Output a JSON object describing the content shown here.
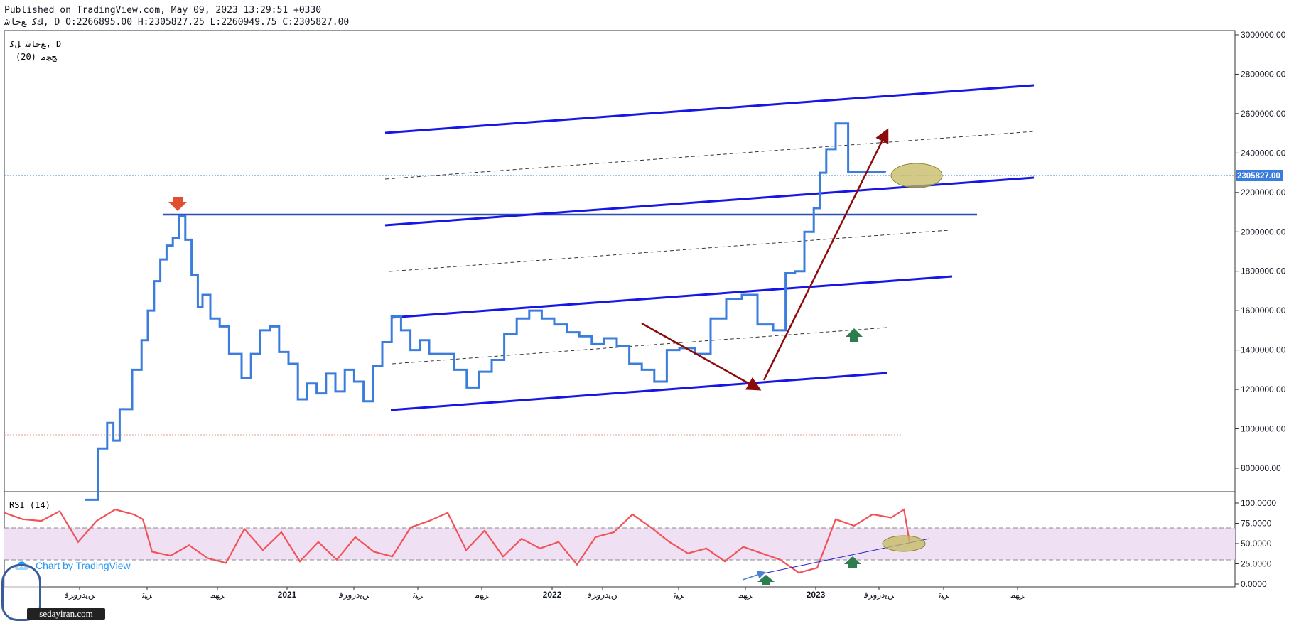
{
  "header": {
    "published": "Published on TradingView.com, May 09, 2023 13:29:51 +0330",
    "symbol_line": "ﻚﮐ ﻊﺧﺎﺷ, D O:2266895.00 H:2305827.25 L:2260949.75 C:2305827.00"
  },
  "legend": {
    "main": "ﻊﺧﺎﺷ ﻞﮐ, D",
    "sub": "(20) ﺞﺠﻣ"
  },
  "rsi": {
    "label": "RSI (14)"
  },
  "price_badge": "2305827.00",
  "brand": {
    "label": "Chart by TradingView"
  },
  "watermark": {
    "text": "sedayiran.com"
  },
  "colors": {
    "price": "#3b7ddd",
    "rsi": "#f05459",
    "channel": "#1616e6",
    "arrow": "#8b0a0a",
    "band": "#f0e0f4",
    "ellipse": "#c4b860",
    "green": "#2e7d4f",
    "red_marker": "#e05030"
  },
  "chart_data": [
    {
      "type": "line",
      "title": "",
      "ylim": [
        620000,
        3050000
      ],
      "y_ticks": [
        "3000000.00",
        "2800000.00",
        "2600000.00",
        "2400000.00",
        "2200000.00",
        "2000000.00",
        "1800000.00",
        "1600000.00",
        "1400000.00",
        "1200000.00",
        "1000000.00",
        "800000.00"
      ],
      "x_ticks": [
        "ﻦﯾﺩﺭﻭﺮﻓ",
        "ﺮﯿﺗ",
        "ﺮﻬﻣ",
        "2021",
        "ﻦﯾﺩﺭﻭﺮﻓ",
        "ﺮﯿﺗ",
        "ﺮﻬﻣ",
        "2022",
        "ﻦﯾﺩﺭﻭﺮﻓ",
        "ﺮﯿﺗ",
        "ﺮﻬﻣ",
        "2023",
        "ﻦﯾﺩﺭﻭﺮﻓ",
        "ﺮﯿﺗ",
        "ﺮﻬﻣ"
      ],
      "series": [
        {
          "x": [
            0,
            8,
            14,
            18,
            22,
            30,
            36,
            40,
            44,
            48,
            52,
            56,
            60,
            64,
            68,
            72,
            75,
            80,
            86,
            92,
            100,
            106,
            112,
            118,
            124,
            130,
            136,
            142,
            148,
            154,
            160,
            166,
            172,
            178,
            184,
            190,
            196,
            202,
            208,
            214,
            220,
            228,
            236,
            244,
            252,
            260,
            268,
            276,
            284,
            292,
            300,
            308,
            316,
            324,
            332,
            340,
            348,
            356,
            364,
            372,
            380,
            390,
            400,
            410,
            420,
            430,
            440,
            448,
            454,
            460,
            466,
            470,
            474,
            480,
            488,
            496,
            500,
            506,
            512
          ],
          "values": [
            640000,
            900000,
            1030000,
            940000,
            1100000,
            1300000,
            1450000,
            1600000,
            1750000,
            1860000,
            1930000,
            1970000,
            2080000,
            1960000,
            1780000,
            1620000,
            1680000,
            1560000,
            1520000,
            1380000,
            1260000,
            1380000,
            1500000,
            1520000,
            1390000,
            1330000,
            1150000,
            1230000,
            1180000,
            1280000,
            1190000,
            1300000,
            1240000,
            1140000,
            1320000,
            1440000,
            1570000,
            1500000,
            1400000,
            1450000,
            1380000,
            1380000,
            1300000,
            1210000,
            1290000,
            1350000,
            1480000,
            1560000,
            1600000,
            1560000,
            1530000,
            1490000,
            1470000,
            1430000,
            1460000,
            1420000,
            1330000,
            1300000,
            1240000,
            1400000,
            1410000,
            1380000,
            1560000,
            1660000,
            1680000,
            1530000,
            1500000,
            1790000,
            1800000,
            2000000,
            2120000,
            2300000,
            2420000,
            2550000,
            2305827,
            2305827,
            2305827,
            2305827,
            2305827
          ]
        }
      ]
    },
    {
      "type": "line",
      "title": "RSI (14)",
      "ylim": [
        0,
        110
      ],
      "y_ticks": [
        "100.0000",
        "75.0000",
        "50.0000",
        "25.0000",
        "0.0000"
      ],
      "levels": [
        70,
        30
      ],
      "series": [
        {
          "x": [
            0,
            10,
            20,
            30,
            40,
            50,
            60,
            70,
            75,
            80,
            90,
            100,
            110,
            120,
            130,
            140,
            150,
            160,
            170,
            180,
            190,
            200,
            210,
            220,
            230,
            240,
            250,
            260,
            270,
            280,
            290,
            300,
            310,
            320,
            330,
            340,
            350,
            360,
            370,
            380,
            390,
            400,
            410,
            420,
            430,
            440,
            450,
            460,
            470,
            480,
            487,
            490
          ],
          "values": [
            88,
            80,
            78,
            90,
            52,
            78,
            92,
            86,
            80,
            40,
            35,
            48,
            32,
            26,
            68,
            42,
            64,
            28,
            52,
            30,
            58,
            40,
            34,
            70,
            78,
            88,
            42,
            66,
            34,
            56,
            44,
            52,
            24,
            58,
            64,
            86,
            70,
            52,
            38,
            44,
            28,
            46,
            38,
            30,
            14,
            20,
            80,
            72,
            86,
            82,
            92,
            52
          ]
        }
      ]
    }
  ]
}
